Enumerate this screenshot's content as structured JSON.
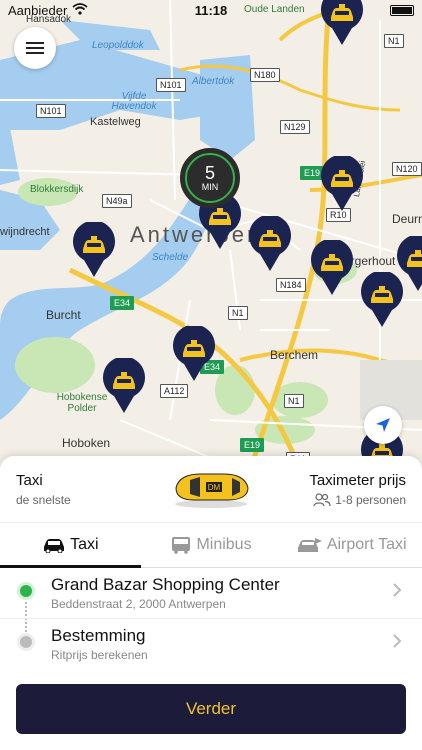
{
  "status_bar": {
    "carrier": "Aanbieder",
    "time": "11:18"
  },
  "map": {
    "city_label": "Antwerpen",
    "labels": {
      "hansadok": "Hansadok",
      "leopolddok": "Leopolddok",
      "albertdok": "Albertdok",
      "vijfde_havendok": "Vijfde Havendok",
      "kastelweg": "Kastelweg",
      "blokkersdijk": "Blokkersdijk",
      "zwijndrecht": "wijndrecht",
      "schelde": "Schelde",
      "burcht": "Burcht",
      "hobokense_polder": "Hobokense Polder",
      "hoboken": "Hoboken",
      "berchem": "Berchem",
      "borgerhout": "Borgerhout",
      "deurne": "Deurn",
      "oude_landen": "Oude Landen",
      "lakborslei": "Lakborslei"
    },
    "roads": {
      "n1_top": "N1",
      "n101_a": "N101",
      "n101_b": "N101",
      "n180": "N180",
      "n129": "N129",
      "n120": "N120",
      "e19_a": "E19",
      "r10": "R10",
      "n49a": "N49a",
      "n184": "N184",
      "e34_a": "E34",
      "e34_b": "E34",
      "n1_mid": "N1",
      "a112": "A112",
      "n1_low": "N1",
      "e19_b": "E19",
      "r11": "R11"
    },
    "eta": {
      "value": "5",
      "unit": "MIN"
    },
    "colors": {
      "pin": "#1b2451",
      "taxi_yellow": "#f4c21e",
      "water": "#a5cdef",
      "green": "#c9e6b5",
      "motorway": "#f5c842"
    }
  },
  "sheet": {
    "service_title": "Taxi",
    "service_sub": "de snelste",
    "price_title": "Taximeter prijs",
    "passengers": "1-8 personen",
    "tabs": [
      {
        "label": "Taxi",
        "icon": "car-icon",
        "active": true
      },
      {
        "label": "Minibus",
        "icon": "minibus-icon",
        "active": false
      },
      {
        "label": "Airport Taxi",
        "icon": "airport-car-icon",
        "active": false
      }
    ],
    "pickup": {
      "title": "Grand Bazar Shopping Center",
      "address": "Beddenstraat 2, 2000 Antwerpen"
    },
    "destination": {
      "title": "Bestemming",
      "sub": "Ritprijs berekenen"
    },
    "cta": "Verder",
    "colors": {
      "cta_bg": "#1c1b3a",
      "cta_text": "#f2c230",
      "pickup_dot": "#2fb24a",
      "dest_dot": "#bbbbbb"
    }
  }
}
